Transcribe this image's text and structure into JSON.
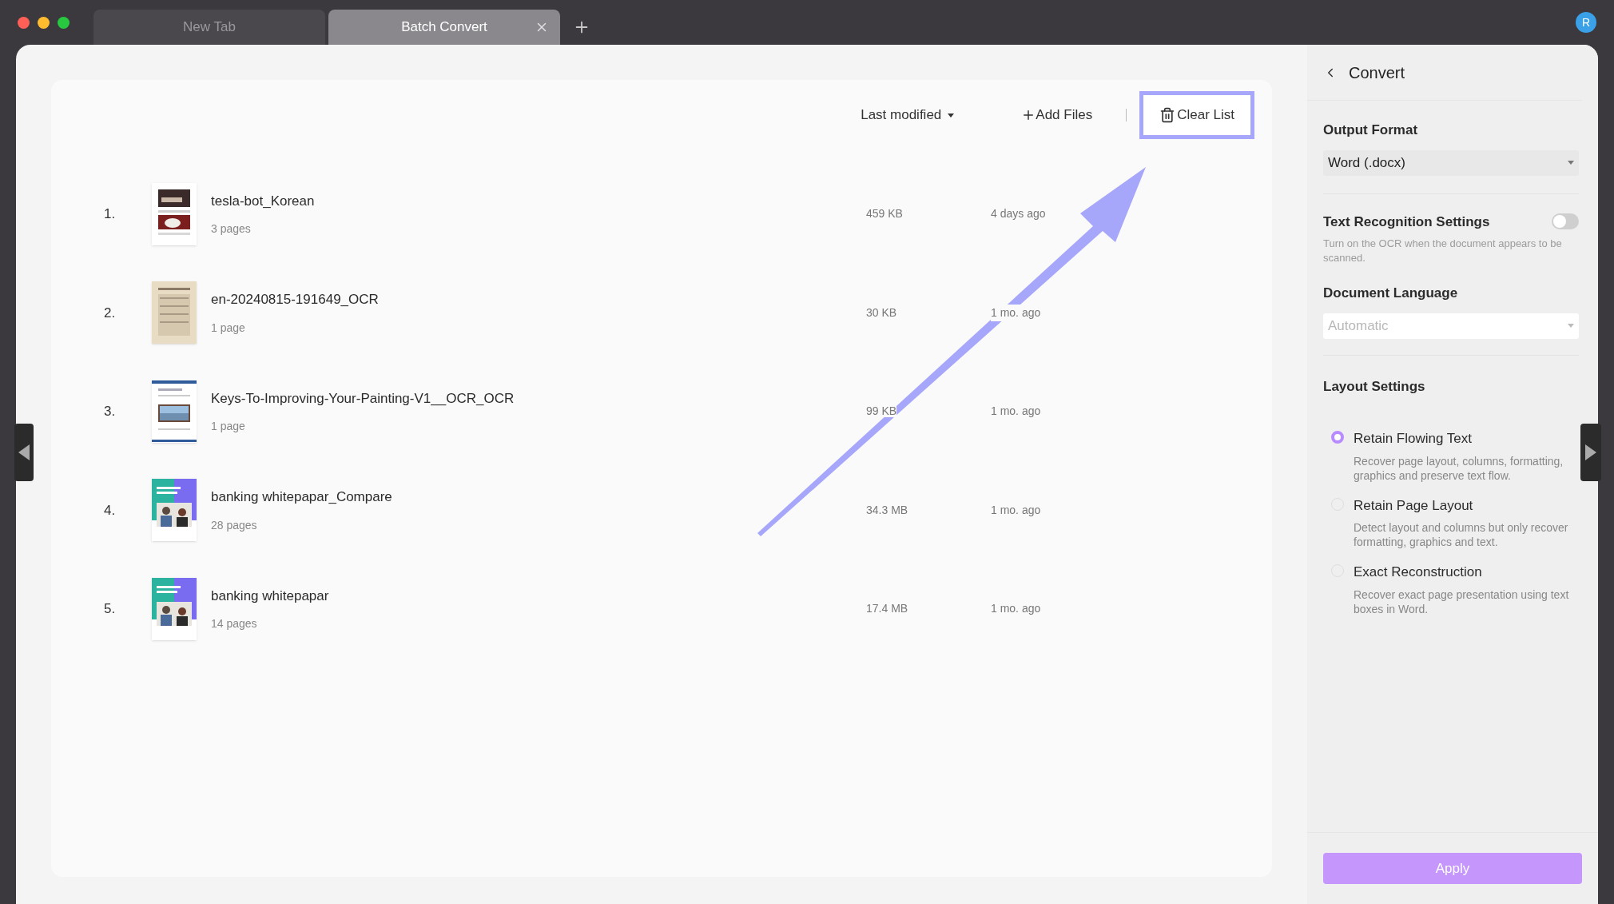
{
  "tabs": [
    {
      "label": "New Tab",
      "selected": false
    },
    {
      "label": "Batch Convert",
      "selected": true
    }
  ],
  "avatar": {
    "initial": "R"
  },
  "toolbar": {
    "sort": "Last modified",
    "add_files": "Add Files",
    "clear_list": "Clear List",
    "clear_list_highlighted": true
  },
  "files": [
    {
      "index": "1.",
      "name": "tesla-bot_Korean",
      "pages": "3 pages",
      "size": "459 KB",
      "modified": "4 days ago"
    },
    {
      "index": "2.",
      "name": "en-20240815-191649_OCR",
      "pages": "1 page",
      "size": "30 KB",
      "modified": "1 mo. ago"
    },
    {
      "index": "3.",
      "name": "Keys-To-Improving-Your-Painting-V1__OCR_OCR",
      "pages": "1 page",
      "size": "99 KB",
      "modified": "1 mo. ago"
    },
    {
      "index": "4.",
      "name": "banking whitepapar_Compare",
      "pages": "28 pages",
      "size": "34.3 MB",
      "modified": "1 mo. ago"
    },
    {
      "index": "5.",
      "name": "banking whitepapar",
      "pages": "14 pages",
      "size": "17.4 MB",
      "modified": "1 mo. ago"
    }
  ],
  "panel": {
    "title": "Convert",
    "output_format": {
      "label": "Output Format",
      "value": "Word (.docx)"
    },
    "ocr": {
      "label": "Text Recognition Settings",
      "on": false,
      "hint": "Turn on the OCR when the document appears to be scanned."
    },
    "language": {
      "label": "Document Language",
      "value": "Automatic",
      "disabled": true
    },
    "layout": {
      "label": "Layout Settings",
      "options": [
        {
          "title": "Retain Flowing Text",
          "description": "Recover page layout, columns, formatting, graphics and preserve text flow.",
          "selected": true
        },
        {
          "title": "Retain Page Layout",
          "description": "Detect layout and columns but only recover formatting, graphics and text.",
          "selected": false
        },
        {
          "title": "Exact Reconstruction",
          "description": "Recover exact page presentation using text boxes in Word.",
          "selected": false
        }
      ]
    },
    "apply": {
      "label": "Apply"
    }
  }
}
